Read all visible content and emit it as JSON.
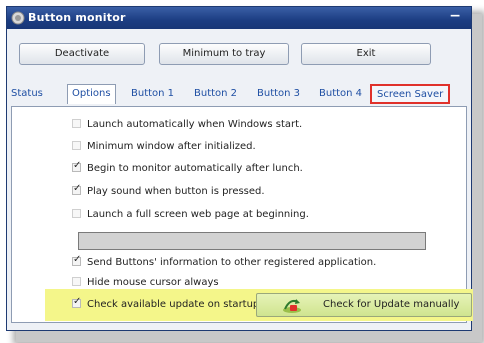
{
  "window": {
    "title": "Button monitor",
    "minimize_glyph": "−"
  },
  "toolbar": {
    "deactivate_label": "Deactivate",
    "tray_label": "Minimum to tray",
    "exit_label": "Exit"
  },
  "tabs": [
    {
      "label": "Status",
      "active": false
    },
    {
      "label": "Options",
      "active": true
    },
    {
      "label": "Button 1",
      "active": false
    },
    {
      "label": "Button 2",
      "active": false
    },
    {
      "label": "Button 3",
      "active": false
    },
    {
      "label": "Button 4",
      "active": false
    },
    {
      "label": "Screen Saver",
      "active": false,
      "highlighted": true
    }
  ],
  "options": [
    {
      "label": "Launch automatically when Windows start.",
      "checked": false
    },
    {
      "label": "Minimum window after initialized.",
      "checked": false
    },
    {
      "label": "Begin to monitor automatically after lunch.",
      "checked": true
    },
    {
      "label": "Play sound when button is pressed.",
      "checked": true
    },
    {
      "label": "Launch a full screen web page at beginning.",
      "checked": false
    },
    {
      "label": "Send Buttons' information to other registered application.",
      "checked": true
    },
    {
      "label": "Hide mouse cursor always",
      "checked": false
    },
    {
      "label": "Check available update on startup",
      "checked": true
    }
  ],
  "web_page_url": {
    "value": ""
  },
  "update_button": {
    "label": "Check for Update manually"
  },
  "colors": {
    "titlebar": "#1c3d82",
    "tab_text": "#1f4fa3",
    "highlight_box": "#e0312b",
    "yellow_highlight": "#f4f68a"
  }
}
